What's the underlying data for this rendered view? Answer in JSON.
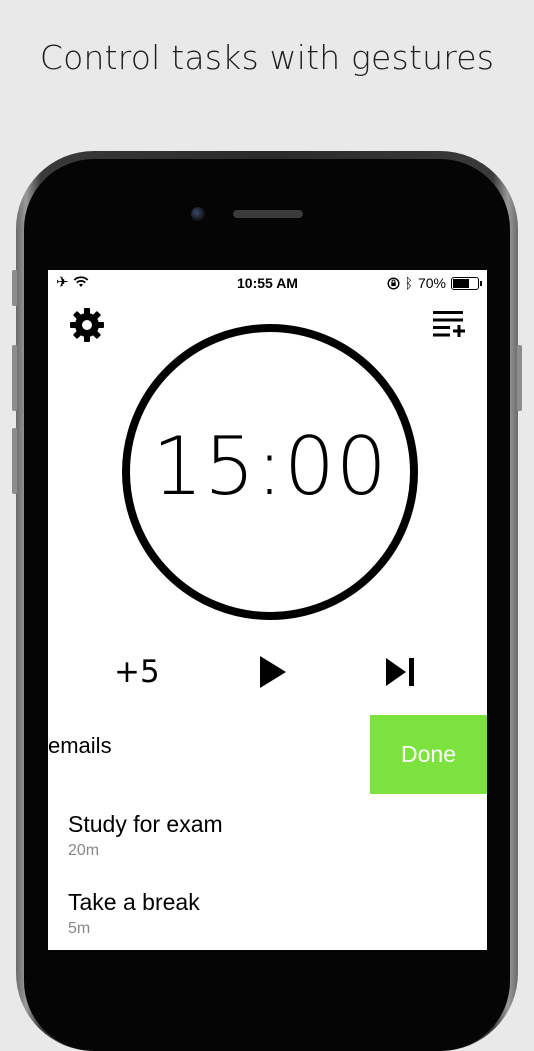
{
  "headline": "Control tasks with gestures",
  "status_bar": {
    "time": "10:55 AM",
    "battery": "70%",
    "battery_level": 0.7
  },
  "icons": {
    "settings": "gear-icon",
    "add_task": "add-to-list-icon",
    "play": "play-icon",
    "skip": "skip-next-icon"
  },
  "timer": {
    "display": "15:00",
    "add_label": "+5"
  },
  "active_task": {
    "title": "emails",
    "done_label": "Done"
  },
  "tasks": [
    {
      "title": "Study for exam",
      "duration": "20m"
    },
    {
      "title": "Take a break",
      "duration": "5m"
    }
  ],
  "colors": {
    "done_green": "#7ce23e",
    "background": "#e9e9e9"
  }
}
